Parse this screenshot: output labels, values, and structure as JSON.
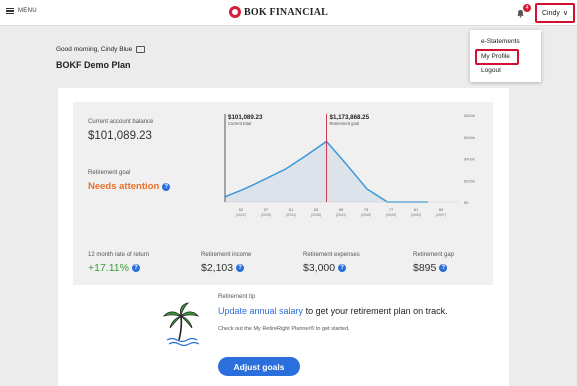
{
  "header": {
    "menu_label": "MENU",
    "logo_text": "BOK FINANCIAL",
    "notification_count": "4",
    "user_name": "Cindy",
    "user_chevron": "∨"
  },
  "user_menu": {
    "items": [
      "e-Statements",
      "My Profile",
      "Logout"
    ]
  },
  "greeting": "Good morning, Cindy Blue",
  "plan_name": "BOKF Demo Plan",
  "summary": {
    "balance_label": "Current account balance",
    "balance_value": "$101,089.23",
    "goal_label": "Retirement goal",
    "goal_status": "Needs attention",
    "info_glyph": "?"
  },
  "metrics": [
    {
      "label": "12 month rate of return",
      "value": "+17.11%"
    },
    {
      "label": "Retirement income",
      "value": "$2,103"
    },
    {
      "label": "Retirement expenses",
      "value": "$3,000"
    },
    {
      "label": "Retirement gap",
      "value": "$895"
    }
  ],
  "chart_data": {
    "type": "area",
    "current_marker": {
      "value": "$101,089.23",
      "label": "Current total"
    },
    "goal_marker": {
      "value": "$1,173,868.25",
      "label": "Retirement goal"
    },
    "y_tick_labels": [
      "$800k",
      "$600k",
      "$400k",
      "$200k",
      "$0"
    ],
    "x_tick_labels": [
      {
        "age": "52",
        "year": "(2022)"
      },
      {
        "age": "57",
        "year": "(2025)"
      },
      {
        "age": "61",
        "year": "(2031)"
      },
      {
        "age": "63",
        "year": "(2036)"
      },
      {
        "age": "65",
        "year": "(2041)"
      },
      {
        "age": "75",
        "year": "(2045)"
      },
      {
        "age": "77",
        "year": "(2049)"
      },
      {
        "age": "81",
        "year": "(2053)"
      },
      {
        "age": "83",
        "year": "(2057)"
      }
    ],
    "series": [
      {
        "values": [
          101089,
          260000,
          450000,
          640000,
          900000,
          1173868,
          720000,
          250000,
          0,
          0,
          0
        ]
      }
    ],
    "colors": {
      "line": "#3a9ad9",
      "fill": "#dde3ea",
      "current_line": "#333333",
      "goal_line": "#d2102f"
    }
  },
  "tip": {
    "label": "Retirement tip",
    "link_text": "Update annual salary",
    "head_rest": " to get your retirement plan on track.",
    "sub_text": "Check out the My RetireRight Planner® to get started.",
    "button_label": "Adjust goals"
  },
  "colors": {
    "accent": "#2a6fdb",
    "brand_red": "#d2102f",
    "attention": "#e8702a",
    "positive": "#3a9a3a"
  }
}
